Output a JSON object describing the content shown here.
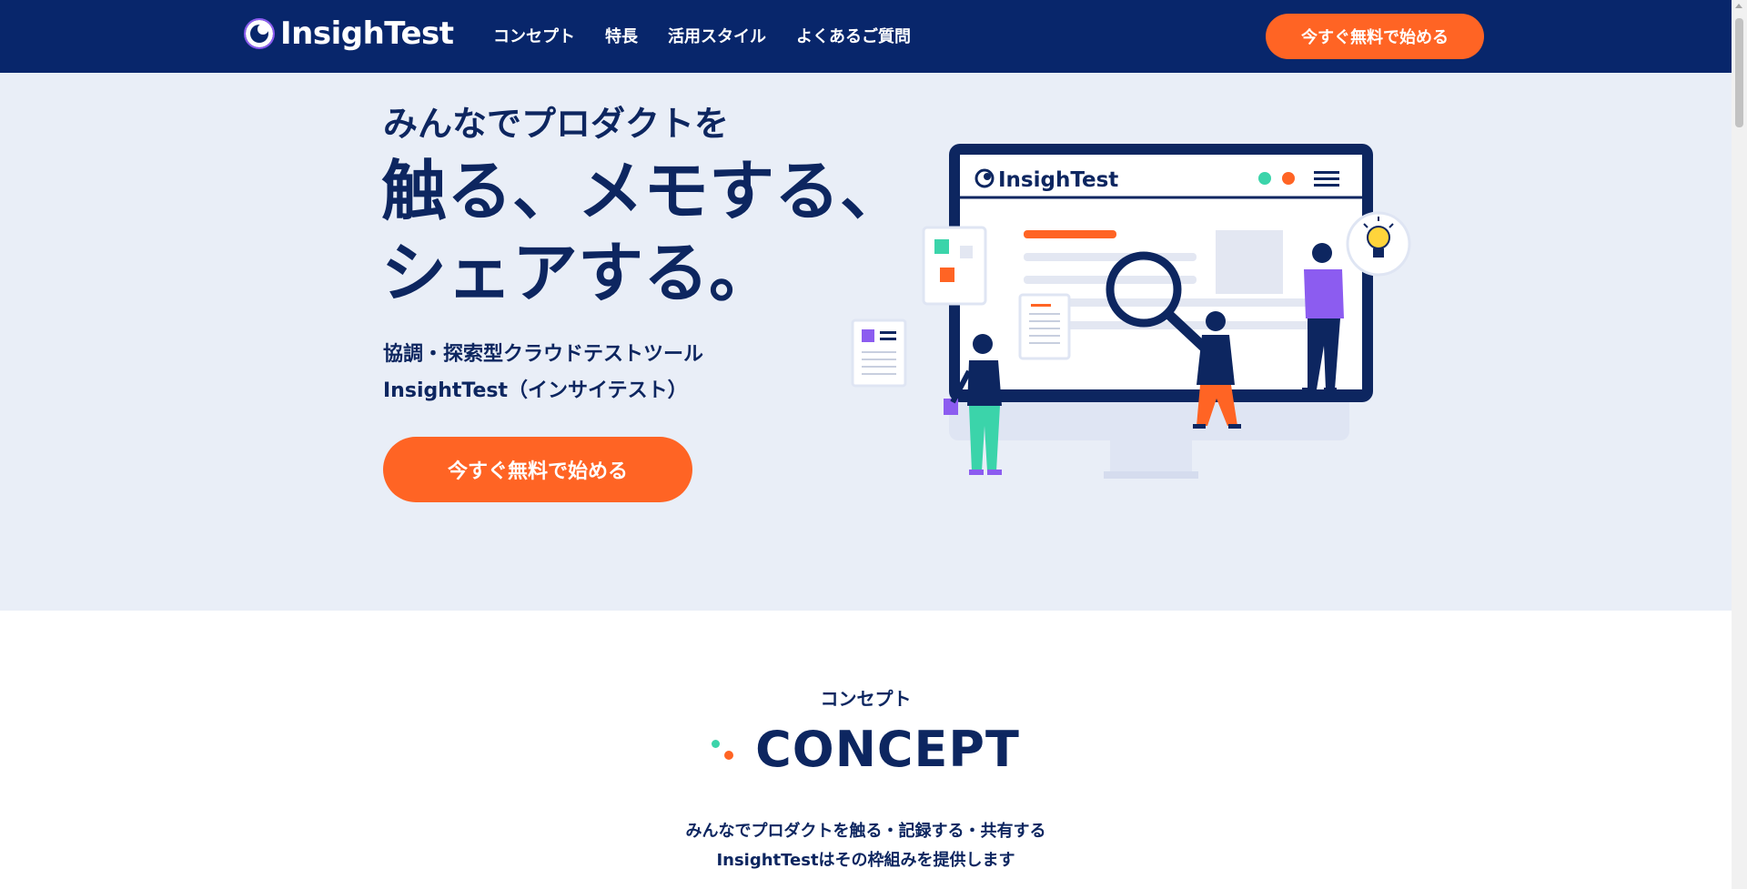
{
  "header": {
    "logo_text": "InsighTest",
    "nav": [
      "コンセプト",
      "特長",
      "活用スタイル",
      "よくあるご質問"
    ],
    "cta_label": "今すぐ無料で始める"
  },
  "hero": {
    "subtitle": "みんなでプロダクトを",
    "title_line1": "触る、メモする、",
    "title_line2": "シェアする。",
    "desc_line1": "協調・探索型クラウドテストツール",
    "desc_line2": "InsightTest（インサイテスト）",
    "cta_label": "今すぐ無料で始める",
    "illustration_logo": "InsighTest"
  },
  "concept": {
    "label": "コンセプト",
    "title": "CONCEPT",
    "text_line1": "みんなでプロダクトを触る・記録する・共有する",
    "text_line2": "InsightTestはその枠組みを提供します"
  },
  "colors": {
    "navy": "#08266b",
    "orange": "#ff6424",
    "hero_bg": "#e9eef7",
    "mint": "#3bd4aa",
    "purple": "#8c5cf0"
  }
}
